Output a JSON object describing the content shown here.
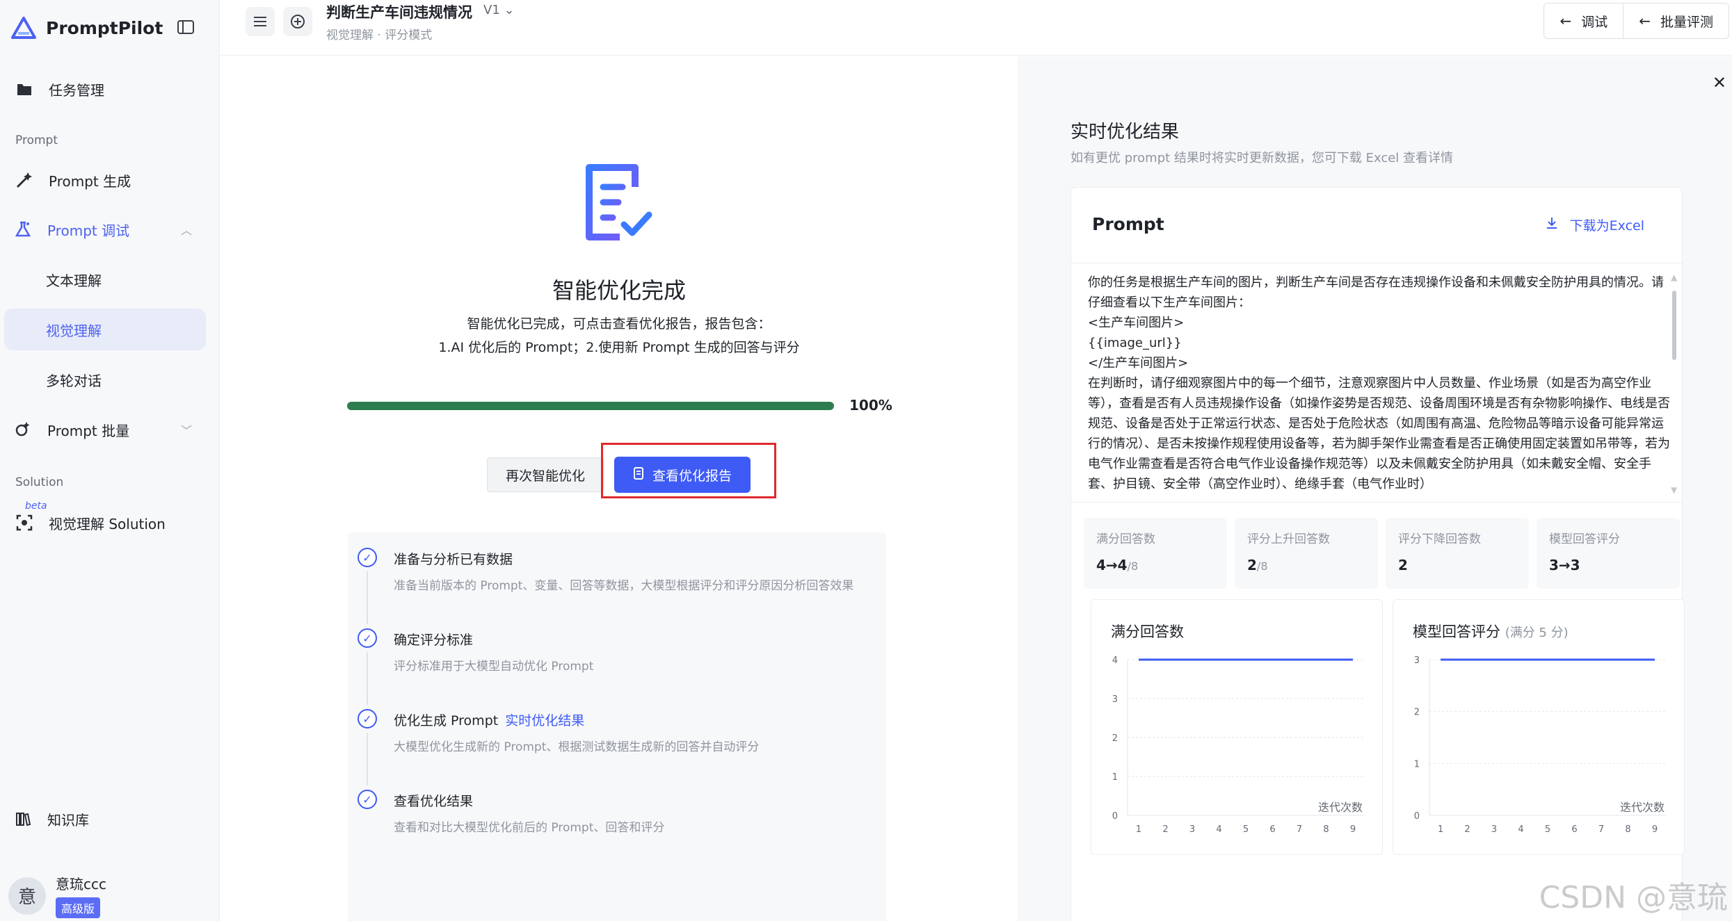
{
  "app": {
    "name": "PromptPilot"
  },
  "sidebar": {
    "task_mgmt": "任务管理",
    "section_prompt": "Prompt",
    "prompt_gen": "Prompt 生成",
    "prompt_debug": "Prompt 调试",
    "sub_text": "文本理解",
    "sub_visual": "视觉理解",
    "sub_multi": "多轮对话",
    "prompt_batch": "Prompt 批量",
    "section_solution": "Solution",
    "beta": "beta",
    "visual_solution": "视觉理解 Solution",
    "knowledge": "知识库",
    "user_avatar": "意",
    "user_name": "意琉ccc",
    "user_tier": "高级版"
  },
  "header": {
    "title": "判断生产车间违规情况",
    "version": "V1",
    "crumb_a": "视觉理解",
    "crumb_sep": "·",
    "crumb_b": "评分模式",
    "debug_btn": "调试",
    "batch_btn": "批量评测"
  },
  "main": {
    "done_title": "智能优化完成",
    "desc_line1": "智能优化已完成，可点击查看优化报告，报告包含：",
    "desc_line2": "1.AI 优化后的 Prompt；2.使用新 Prompt 生成的回答与评分",
    "progress_value": 100,
    "progress_text": "100%",
    "retry_btn": "再次智能优化",
    "report_btn": "查看优化报告",
    "steps": [
      {
        "title": "准备与分析已有数据",
        "link": "",
        "desc": "准备当前版本的 Prompt、变量、回答等数据，大模型根据评分和评分原因分析回答效果"
      },
      {
        "title": "确定评分标准",
        "link": "",
        "desc": "评分标准用于大模型自动优化 Prompt"
      },
      {
        "title": "优化生成 Prompt",
        "link": "实时优化结果",
        "desc": "大模型优化生成新的 Prompt、根据测试数据生成新的回答并自动评分"
      },
      {
        "title": "查看优化结果",
        "link": "",
        "desc": "查看和对比大模型优化前后的 Prompt、回答和评分"
      }
    ]
  },
  "right": {
    "title": "实时优化结果",
    "subtitle": "如有更优 prompt 结果时将实时更新数据，您可下载 Excel 查看详情",
    "card_title": "Prompt",
    "download": "下载为Excel",
    "prompt_text": "你的任务是根据生产车间的图片，判断生产车间是否存在违规操作设备和未佩戴安全防护用具的情况。请仔细查看以下生产车间图片：\n<生产车间图片>\n{{image_url}}\n</生产车间图片>\n在判断时，请仔细观察图片中的每一个细节，注意观察图片中人员数量、作业场景（如是否为高空作业等），查看是否有人员违规操作设备（如操作姿势是否规范、设备周围环境是否有杂物影响操作、电线是否规范、设备是否处于正常运行状态、是否处于危险状态（如周围有高温、危险物品等暗示设备可能异常运行的情况）、是否未按操作规程使用设备等，若为脚手架作业需查看是否正确使用固定装置如吊带等，若为电气作业需查看是否符合电气作业设备操作规范等）以及未佩戴安全防护用具（如未戴安全帽、安全手套、护目镜、安全带（高空作业时）、绝缘手套（电气作业时）",
    "stats": [
      {
        "label": "满分回答数",
        "value": "4→4",
        "suffix": "/8"
      },
      {
        "label": "评分上升回答数",
        "value": "2",
        "suffix": "/8"
      },
      {
        "label": "评分下降回答数",
        "value": "2",
        "suffix": ""
      },
      {
        "label": "模型回答评分",
        "value": "3→3",
        "suffix": ""
      }
    ]
  },
  "chart_data": [
    {
      "type": "line",
      "title": "满分回答数",
      "xlabel": "迭代次数",
      "x": [
        1,
        2,
        3,
        4,
        5,
        6,
        7,
        8,
        9
      ],
      "y": [
        4,
        4,
        4,
        4,
        4,
        4,
        4,
        4,
        4
      ],
      "yticks": [
        0,
        1,
        2,
        3,
        4
      ],
      "ylim": [
        0,
        4
      ],
      "color": "#3e5bf5",
      "grid": true
    },
    {
      "type": "line",
      "title": "模型回答评分",
      "title_note": "(满分 5 分)",
      "xlabel": "迭代次数",
      "x": [
        1,
        2,
        3,
        4,
        5,
        6,
        7,
        8,
        9
      ],
      "y": [
        3,
        3,
        3,
        3,
        3,
        3,
        3,
        3,
        3
      ],
      "yticks": [
        0,
        1,
        2,
        3
      ],
      "ylim": [
        0,
        3
      ],
      "color": "#3e5bf5",
      "grid": true
    }
  ],
  "watermark": "CSDN @意琉"
}
